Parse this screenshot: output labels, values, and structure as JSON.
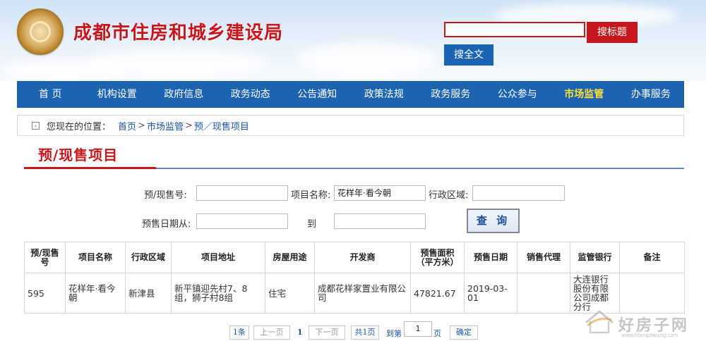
{
  "header": {
    "site_title": "成都市住房和城乡建设局",
    "search_title_btn": "搜标题",
    "search_full_btn": "搜全文",
    "search_value": ""
  },
  "nav": {
    "items": [
      "首 页",
      "机构设置",
      "政府信息",
      "政务动态",
      "公告通知",
      "政策法规",
      "政务服务",
      "公众参与",
      "市场监管",
      "办事服务"
    ],
    "active": "市场监管"
  },
  "breadcrumb": {
    "prefix": "您现在的位置：",
    "items": [
      "首页",
      "市场监管",
      "预／现售项目"
    ],
    "sep": ">"
  },
  "section": {
    "title": "预/现售项目"
  },
  "form": {
    "presale_no_label": "预/现售号:",
    "presale_no_value": "",
    "project_name_label": "项目名称:",
    "project_name_value": "花样年·看今朝",
    "district_label": "行政区域:",
    "district_value": "",
    "date_from_label": "预售日期从:",
    "date_from_value": "",
    "date_to_label": "到",
    "date_to_value": "",
    "query_btn": "查 询"
  },
  "table": {
    "headers": [
      "预/现售号",
      "项目名称",
      "行政区域",
      "项目地址",
      "房屋用途",
      "开发商",
      "预售面积（平方米）",
      "预售日期",
      "销售代理",
      "监管银行",
      "备注"
    ],
    "rows": [
      [
        "595",
        "花样年·看今朝",
        "新津县",
        "新平镇迎先村7、8组，狮子村8组",
        "住宅",
        "成都花样家置业有限公司",
        "47821.67",
        "2019-03-01",
        "",
        "大连银行股份有限公司成都分行",
        ""
      ]
    ]
  },
  "pager": {
    "count": "1条",
    "prev": "上一页",
    "current": "1",
    "next": "下一页",
    "total_pages": "共1页",
    "goto_prefix": "到第",
    "goto_value": "1",
    "goto_suffix": "页",
    "confirm": "确定"
  },
  "watermark": {
    "text": "好房子网",
    "url": "www.hfangziwang.com"
  },
  "colors": {
    "brand_red": "#c8161d",
    "nav_blue": "#1c63b2",
    "nav_active": "#ffe135"
  }
}
